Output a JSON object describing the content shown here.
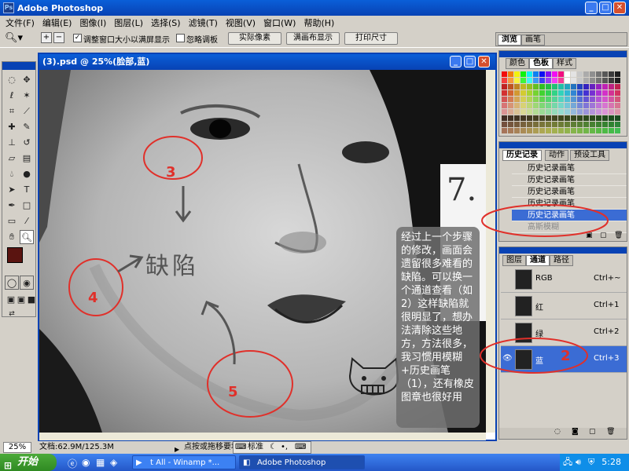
{
  "app": {
    "title": "Adobe Photoshop"
  },
  "menu": [
    "文件(F)",
    "编辑(E)",
    "图像(I)",
    "图层(L)",
    "选择(S)",
    "滤镜(T)",
    "视图(V)",
    "窗口(W)",
    "帮助(H)"
  ],
  "options": {
    "resize_label": "调整窗口大小以满屏显示",
    "ignore_palettes_label": "忽略调板",
    "actual_pixels": "实际像素",
    "fit_screen": "满画布显示",
    "print_size": "打印尺寸",
    "resize_checked": true,
    "ignore_checked": false
  },
  "palette_well": {
    "tab1": "浏览",
    "tab2": "画笔"
  },
  "document": {
    "title": "(3).psd @ 25%(脸部,蓝)"
  },
  "annotations": {
    "n3": "3",
    "n4": "4",
    "n5": "5",
    "n2": "2",
    "n7": "7.",
    "defect": "缺陷",
    "note": "经过上一个步骤的修改，画面会遗留很多难看的缺陷。可以换一个通道查看（如2）这样缺陷就很明显了，想办法清除这些地方，方法很多，我习惯用模糊+历史画笔（1），还有橡皮图章也很好用"
  },
  "swatches_panel": {
    "tabs": [
      "颜色",
      "色板",
      "样式"
    ],
    "active": 1
  },
  "history_panel": {
    "tabs": [
      "历史记录",
      "动作",
      "预设工具"
    ],
    "active": 0,
    "items": [
      "历史记录画笔",
      "历史记录画笔",
      "历史记录画笔",
      "历史记录画笔",
      "历史记录画笔",
      "高斯模糊"
    ],
    "selected": 4
  },
  "channels_panel": {
    "tabs": [
      "图层",
      "通道",
      "路径"
    ],
    "active": 1,
    "channels": [
      {
        "name": "RGB",
        "shortcut": "Ctrl+~"
      },
      {
        "name": "红",
        "shortcut": "Ctrl+1"
      },
      {
        "name": "绿",
        "shortcut": "Ctrl+2"
      },
      {
        "name": "蓝",
        "shortcut": "Ctrl+3"
      }
    ],
    "selected": 3
  },
  "status": {
    "zoom": "25%",
    "doc_size": "文档:62.9M/125.3M",
    "hint": "点按或拖移要地"
  },
  "ime": {
    "label": "标准"
  },
  "taskbar": {
    "start": "开始",
    "tasks": [
      {
        "label": "t All - Winamp *..."
      },
      {
        "label": "Adobe Photoshop"
      }
    ],
    "clock": "5:28"
  },
  "colors": {
    "accent": "#0842b4",
    "selection": "#3b6cd4",
    "annotation_red": "#e0302a"
  }
}
